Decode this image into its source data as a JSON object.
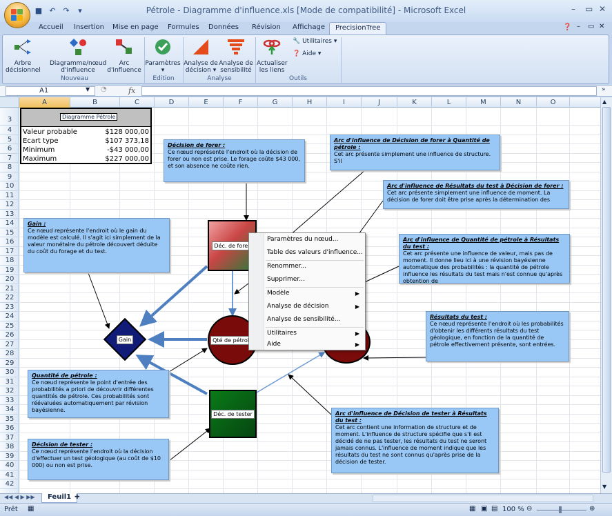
{
  "window": {
    "title": "Pétrole - Diagramme d'influence.xls  [Mode de compatibilité] - Microsoft Excel"
  },
  "ribbon_tabs": [
    "Accueil",
    "Insertion",
    "Mise en page",
    "Formules",
    "Données",
    "Révision",
    "Affichage",
    "PrecisionTree"
  ],
  "ribbon": {
    "buttons": [
      {
        "l1": "Arbre",
        "l2": "décisionnel"
      },
      {
        "l1": "Diagramme/nœud",
        "l2": "d'influence"
      },
      {
        "l1": "Arc",
        "l2": "d'influence"
      },
      {
        "l1": "Paramètres",
        "l2": "▾"
      },
      {
        "l1": "Analyse de",
        "l2": "décision ▾"
      },
      {
        "l1": "Analyse de",
        "l2": "sensibilité"
      },
      {
        "l1": "Actualiser",
        "l2": "les liens"
      }
    ],
    "small": [
      "Utilitaires ▾",
      "Aide ▾"
    ],
    "groups": [
      "Nouveau",
      "Edition",
      "Analyse",
      "Outils"
    ]
  },
  "formula": {
    "namebox": "A1",
    "fx": "fx"
  },
  "columns": [
    "A",
    "B",
    "C",
    "D",
    "E",
    "F",
    "G",
    "H",
    "I",
    "J",
    "K",
    "L",
    "M",
    "N",
    "O"
  ],
  "rows": [
    "3",
    "4",
    "5",
    "6",
    "7",
    "8",
    "9",
    "10",
    "11",
    "12",
    "13",
    "14",
    "15",
    "16",
    "17",
    "18",
    "19",
    "20",
    "21",
    "22",
    "23",
    "24",
    "25",
    "26",
    "27",
    "28",
    "29",
    "30",
    "31",
    "32",
    "33",
    "34",
    "35",
    "36",
    "37",
    "38",
    "39",
    "40",
    "41",
    "42"
  ],
  "summary": {
    "title": "Diagramme Pétrole",
    "rows": [
      {
        "label": "Valeur probable",
        "value": "$128 000,00"
      },
      {
        "label": "Ecart type",
        "value": "$107 373,18"
      },
      {
        "label": "Minimum",
        "value": "-$43 000,00"
      },
      {
        "label": "Maximum",
        "value": "$227 000,00"
      }
    ]
  },
  "notes": {
    "forer": {
      "title": "Décision de forer :",
      "body": "Ce nœud représente l'endroit où la décision de forer ou non est prise. Le forage coûte $43 000, et son absence ne coûte rien."
    },
    "gain": {
      "title": "Gain :",
      "body": "Ce nœud représente l'endroit où le gain du modèle est calculé. Il s'agit ici simplement de la valeur monétaire du pétrole découvert déduite du coût du forage et du test."
    },
    "qte": {
      "title": "Quantité de pétrole :",
      "body": "Ce nœud représente le point d'entrée des probabilités a priori de découvrir différentes quantités de pétrole. Ces probabilités sont réévaluées automatiquement par révision bayésienne."
    },
    "tester": {
      "title": "Décision de tester :",
      "body": "Ce nœud représente l'endroit où la décision d'effectuer un test géologique (au coût de $10 000) ou non est prise."
    },
    "arc1": {
      "title": "Arc d'influence de Décision de forer à Quantité de pétrole :",
      "body": "Cet arc présente simplement une influence de structure. S'il"
    },
    "arc2": {
      "title": "Arc d'influence de Résultats du test à Décision de forer :",
      "body": "Cet arc présente simplement une influence de moment. La décision de forer doit être prise après la détermination des"
    },
    "arc3": {
      "title": "Arc d'influence de Quantité de pétrole à Résultats du test :",
      "body": "Cet arc présente une influence de valeur, mais pas de moment. Il donne lieu ici à une révision bayésienne automatique des probabilités : la quantité de pétrole influence les résultats du test mais n'est connue qu'après obtention de"
    },
    "resultats": {
      "title": "Résultats du test :",
      "body": "Ce nœud représente l'endroit où les probabilités d'obtenir les différents résultats du test géologique, en fonction de la quantité de pétrole effectivement présente, sont entrées."
    },
    "arc4": {
      "title": "Arc d'influence de Décision de tester à Résultats du test :",
      "body": "Cet arc contient une information de structure et de moment. L'influence de structure spécifie que s'il est décidé de ne pas tester, les résultats du test ne seront jamais connus. L'influence de moment indique que les résultats du test ne sont connus qu'après prise de la décision de tester."
    }
  },
  "nodes": {
    "forer": "Déc. de forer",
    "gain": "Gain",
    "qte": "Qté de pétrole",
    "tester": "Déc. de tester"
  },
  "context_menu": [
    "Paramètres du nœud...",
    "Table des valeurs d'influence...",
    "Renommer...",
    "Supprimer...",
    "Modèle",
    "Analyse de décision",
    "Analyse de sensibilité...",
    "Utilitaires",
    "Aide"
  ],
  "sheet_tab": "Feuil1",
  "status": {
    "left": "Prêt",
    "zoom": "100 %"
  },
  "colors": {
    "accent": "#8fa9d0",
    "note": "#99c8f6"
  }
}
